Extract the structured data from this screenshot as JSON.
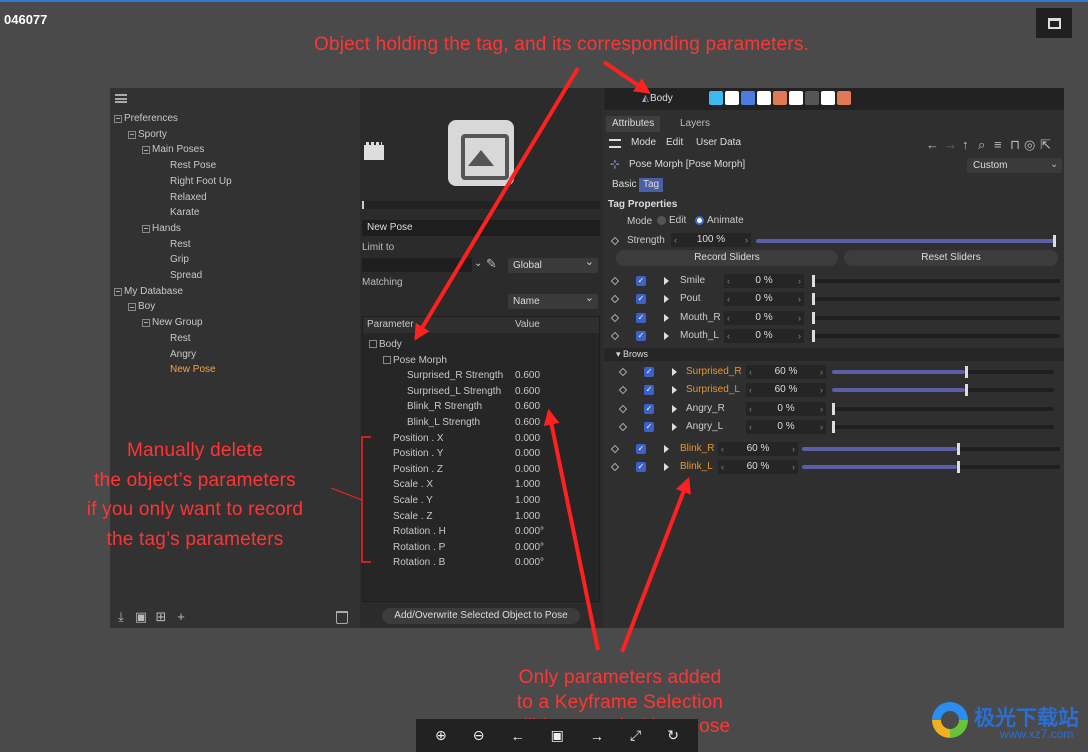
{
  "image_id": "046077",
  "left_panel": {
    "tree": [
      {
        "label": "Preferences",
        "level": 0
      },
      {
        "label": "Sporty",
        "level": 1
      },
      {
        "label": "Main Poses",
        "level": 2
      },
      {
        "label": "Rest Pose",
        "level": 3
      },
      {
        "label": "Right Foot Up",
        "level": 3
      },
      {
        "label": "Relaxed",
        "level": 3
      },
      {
        "label": "Karate",
        "level": 3
      },
      {
        "label": "Hands",
        "level": 2
      },
      {
        "label": "Rest",
        "level": 3
      },
      {
        "label": "Grip",
        "level": 3
      },
      {
        "label": "Spread",
        "level": 3
      },
      {
        "label": "My Database",
        "level": 0
      },
      {
        "label": "Boy",
        "level": 1
      },
      {
        "label": "New Group",
        "level": 2
      },
      {
        "label": "Rest",
        "level": 3
      },
      {
        "label": "Angry",
        "level": 3
      },
      {
        "label": "New Pose",
        "level": 3,
        "selected": true
      }
    ]
  },
  "middle_panel": {
    "pose_name": "New Pose",
    "limit_to_label": "Limit to",
    "limit_mode": "Global",
    "matching_label": "Matching",
    "matching_mode": "Name",
    "table_headers": [
      "Parameter",
      "Value"
    ],
    "rows": [
      {
        "name": "Body",
        "value": "",
        "indent": 0
      },
      {
        "name": "Pose Morph",
        "value": "",
        "indent": 1
      },
      {
        "name": "Surprised_R Strength",
        "value": "0.600",
        "indent": 2
      },
      {
        "name": "Surprised_L Strength",
        "value": "0.600",
        "indent": 2
      },
      {
        "name": "Blink_R Strength",
        "value": "0.600",
        "indent": 2
      },
      {
        "name": "Blink_L Strength",
        "value": "0.600",
        "indent": 2
      },
      {
        "name": "Position . X",
        "value": "0.000",
        "indent": 1
      },
      {
        "name": "Position . Y",
        "value": "0.000",
        "indent": 1
      },
      {
        "name": "Position . Z",
        "value": "0.000",
        "indent": 1
      },
      {
        "name": "Scale . X",
        "value": "1.000",
        "indent": 1
      },
      {
        "name": "Scale . Y",
        "value": "1.000",
        "indent": 1
      },
      {
        "name": "Scale . Z",
        "value": "1.000",
        "indent": 1
      },
      {
        "name": "Rotation . H",
        "value": "0.000°",
        "indent": 1
      },
      {
        "name": "Rotation . P",
        "value": "0.000°",
        "indent": 1
      },
      {
        "name": "Rotation . B",
        "value": "0.000°",
        "indent": 1
      }
    ],
    "add_button": "Add/Overwrite Selected Object to Pose"
  },
  "right_panel": {
    "object_name": "Body",
    "tag_colors": [
      "#3db8f0",
      "#ffffff",
      "#4a7de0",
      "#ffffff",
      "#e07a55",
      "#ffffff",
      "#555555",
      "#ffffff",
      "#e07a55"
    ],
    "tabs": [
      "Attributes",
      "Layers"
    ],
    "menu": [
      "Mode",
      "Edit",
      "User Data"
    ],
    "tag_title": "Pose Morph [Pose Morph]",
    "custom": "Custom",
    "sub_tabs": [
      "Basic",
      "Tag"
    ],
    "section": "Tag Properties",
    "mode_label": "Mode",
    "mode_options": [
      "Edit",
      "Animate"
    ],
    "strength_label": "Strength",
    "strength_value": "100 %",
    "strength_fraction": 1.0,
    "record_btn": "Record Sliders",
    "reset_btn": "Reset Sliders",
    "brows_label": "Brows",
    "sliders": [
      {
        "name": "Smile",
        "value": "0 %",
        "fraction": 0,
        "highlight": false,
        "group": "main"
      },
      {
        "name": "Pout",
        "value": "0 %",
        "fraction": 0,
        "highlight": false,
        "group": "main"
      },
      {
        "name": "Mouth_R",
        "value": "0 %",
        "fraction": 0,
        "highlight": false,
        "group": "main"
      },
      {
        "name": "Mouth_L",
        "value": "0 %",
        "fraction": 0,
        "highlight": false,
        "group": "main"
      },
      {
        "name": "Surprised_R",
        "value": "60 %",
        "fraction": 0.6,
        "highlight": true,
        "group": "brows"
      },
      {
        "name": "Surprised_L",
        "value": "60 %",
        "fraction": 0.6,
        "highlight": true,
        "group": "brows"
      },
      {
        "name": "Angry_R",
        "value": "0 %",
        "fraction": 0,
        "highlight": false,
        "group": "brows"
      },
      {
        "name": "Angry_L",
        "value": "0 %",
        "fraction": 0,
        "highlight": false,
        "group": "brows"
      },
      {
        "name": "Blink_R",
        "value": "60 %",
        "fraction": 0.6,
        "highlight": true,
        "group": "eyes"
      },
      {
        "name": "Blink_L",
        "value": "60 %",
        "fraction": 0.6,
        "highlight": true,
        "group": "eyes"
      }
    ]
  },
  "annotations": {
    "top": "Object holding the tag, and its corresponding parameters.",
    "left": [
      "Manually delete",
      "the object’s parameters",
      "if you only want to record",
      "the tag’s parameters"
    ],
    "bottom": [
      "Only parameters added",
      "to a Keyframe Selection",
      "will be recorded in a pose"
    ]
  },
  "watermark": {
    "title": "极光下载站",
    "url": "www.xz7.com"
  }
}
